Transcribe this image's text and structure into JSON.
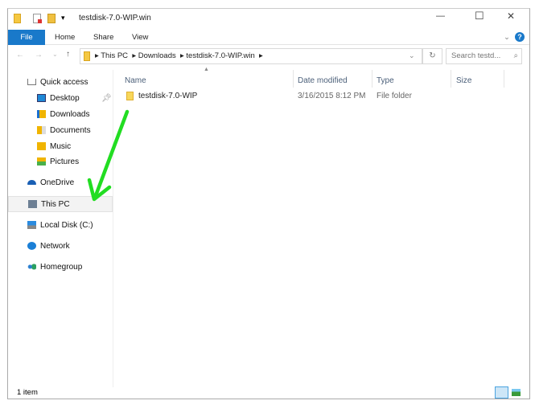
{
  "window": {
    "title": "testdisk-7.0-WIP.win",
    "min": "—",
    "max": "☐",
    "close": "✕"
  },
  "ribbon": {
    "tabs": [
      "File",
      "Home",
      "Share",
      "View"
    ],
    "collapse": "⌄",
    "help": "?"
  },
  "address": {
    "crumbs": [
      "This PC",
      "Downloads",
      "testdisk-7.0-WIP.win"
    ],
    "search_placeholder": "Search testd..."
  },
  "nav": {
    "items": [
      {
        "label": "Quick access",
        "icon": "star-home-icon"
      },
      {
        "label": "Desktop",
        "icon": "desktop-icon"
      },
      {
        "label": "Downloads",
        "icon": "downloads-icon"
      },
      {
        "label": "Documents",
        "icon": "documents-icon"
      },
      {
        "label": "Music",
        "icon": "music-icon"
      },
      {
        "label": "Pictures",
        "icon": "pictures-icon"
      },
      {
        "label": "OneDrive",
        "icon": "onedrive-icon"
      },
      {
        "label": "This PC",
        "icon": "computer-icon"
      },
      {
        "label": "Local Disk (C:)",
        "icon": "drive-icon"
      },
      {
        "label": "Network",
        "icon": "network-icon"
      },
      {
        "label": "Homegroup",
        "icon": "homegroup-icon"
      }
    ]
  },
  "columns": [
    "Name",
    "Date modified",
    "Type",
    "Size"
  ],
  "files": [
    {
      "name": "testdisk-7.0-WIP",
      "date": "3/16/2015 8:12 PM",
      "type": "File folder",
      "size": ""
    }
  ],
  "status": {
    "count": "1 item"
  },
  "colors": {
    "accent": "#1979ca",
    "folder": "#f5c842",
    "arrow": "#22dd22"
  }
}
